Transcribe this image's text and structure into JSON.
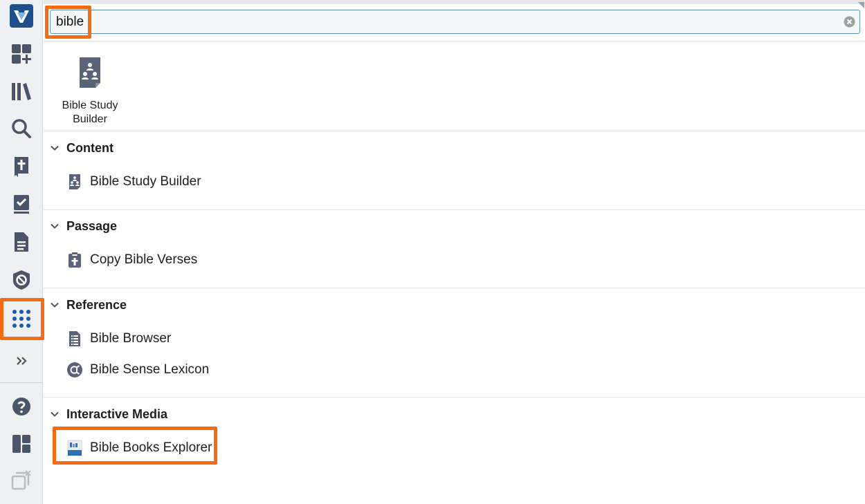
{
  "colors": {
    "accent": "#f36c12",
    "icon": "#4a5568",
    "brand": "#1f4f8a",
    "apps_icon": "#1a5aa6"
  },
  "rail": {
    "items": [
      {
        "name": "logos-logo-icon"
      },
      {
        "name": "layouts-add-icon"
      },
      {
        "name": "library-icon"
      },
      {
        "name": "search-icon"
      },
      {
        "name": "bible-icon"
      },
      {
        "name": "reading-plan-icon"
      },
      {
        "name": "documents-icon"
      },
      {
        "name": "factbook-icon"
      },
      {
        "name": "apps-grid-icon"
      },
      {
        "name": "expand-chevrons-icon"
      },
      {
        "name": "help-icon"
      },
      {
        "name": "layouts-icon"
      },
      {
        "name": "close-panels-icon"
      }
    ]
  },
  "search": {
    "value": "bible",
    "placeholder": ""
  },
  "top_result": {
    "label": "Bible Study\nBuilder",
    "icon": "bible-study-builder-icon"
  },
  "sections": [
    {
      "title": "Content",
      "items": [
        {
          "label": "Bible Study Builder",
          "icon": "bible-study-builder-icon"
        }
      ]
    },
    {
      "title": "Passage",
      "items": [
        {
          "label": "Copy Bible Verses",
          "icon": "copy-bible-verses-icon"
        }
      ]
    },
    {
      "title": "Reference",
      "items": [
        {
          "label": "Bible Browser",
          "icon": "bible-browser-icon"
        },
        {
          "label": "Bible Sense Lexicon",
          "icon": "bible-sense-lexicon-icon"
        }
      ]
    },
    {
      "title": "Interactive Media",
      "items": [
        {
          "label": "Bible Books Explorer",
          "icon": "bible-books-explorer-icon"
        }
      ]
    }
  ]
}
